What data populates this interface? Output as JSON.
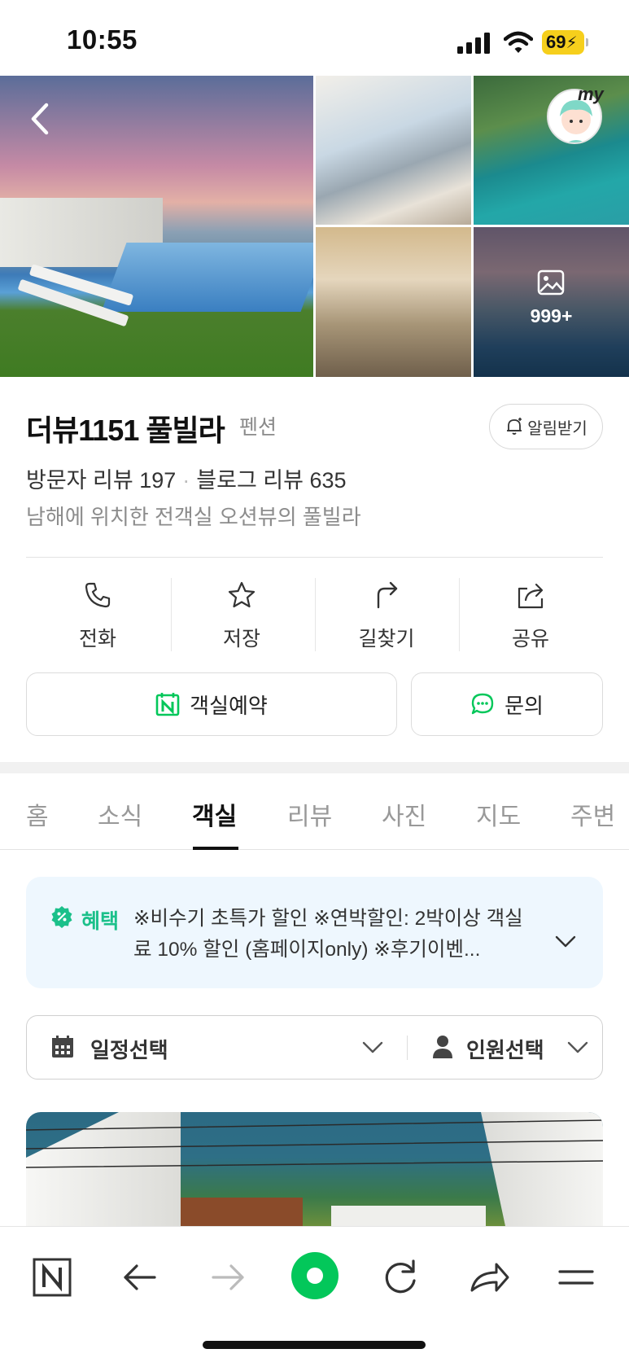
{
  "status_bar": {
    "time": "10:55",
    "battery": "69"
  },
  "gallery": {
    "more_count": "999+",
    "my_label": "my"
  },
  "place": {
    "name": "더뷰1151 풀빌라",
    "category": "펜션",
    "alarm_label": "알림받기",
    "visitor_reviews": "방문자 리뷰 197",
    "blog_reviews": "블로그 리뷰 635",
    "description": "남해에 위치한 전객실 오션뷰의 풀빌라"
  },
  "actions": {
    "call": "전화",
    "save": "저장",
    "directions": "길찾기",
    "share": "공유"
  },
  "buttons": {
    "reserve": "객실예약",
    "inquiry": "문의"
  },
  "tabs": [
    "홈",
    "소식",
    "객실",
    "리뷰",
    "사진",
    "지도",
    "주변"
  ],
  "active_tab": "객실",
  "benefit": {
    "label": "혜택",
    "text": "※비수기 초특가 할인 ※연박할인: 2박이상 객실료 10% 할인 (홈페이지only) ※후기이벤..."
  },
  "selector": {
    "date": "일정선택",
    "people": "인원선택"
  },
  "colors": {
    "accent_green": "#1bc08a",
    "naver_green": "#03c75a",
    "benefit_bg": "#eef7fe",
    "battery_yellow": "#f6cf1c"
  },
  "icons": {
    "back": "chevron-left-icon",
    "call": "phone-icon",
    "save": "star-icon",
    "directions": "turn-arrow-icon",
    "share": "share-icon",
    "reserve": "naver-calendar-icon",
    "inquiry": "chat-bubble-icon",
    "benefit": "discount-badge-icon",
    "date": "calendar-icon",
    "people": "person-icon",
    "toolbar": [
      "naver-n-icon",
      "back-arrow-icon",
      "forward-arrow-icon",
      "green-dot-icon",
      "refresh-icon",
      "share-arrow-icon",
      "menu-icon"
    ]
  }
}
